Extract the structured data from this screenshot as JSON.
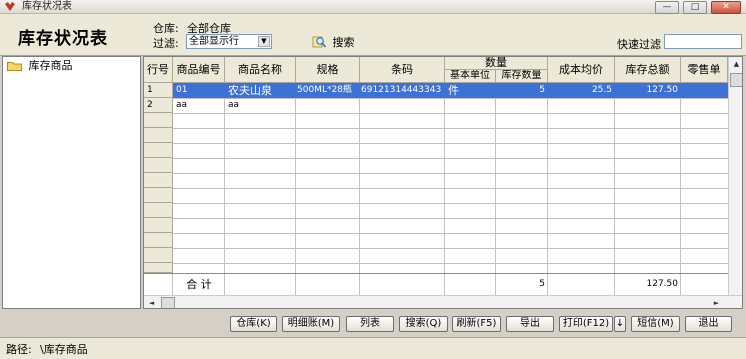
{
  "window": {
    "title": "库存状况表",
    "min_label": "—",
    "max_label": "□",
    "close_label": "✕"
  },
  "header": {
    "page_title": "库存状况表",
    "warehouse_label": "仓库:",
    "warehouse_value": "全部仓库",
    "filter_label": "过滤:",
    "filter_value": "全部显示行",
    "search_label": "搜索",
    "quick_filter_label": "快速过滤",
    "quick_filter_value": ""
  },
  "tree": {
    "items": [
      {
        "label": "库存商品",
        "icon": "folder-icon"
      }
    ]
  },
  "grid": {
    "columns": {
      "row_no": "行号",
      "code": "商品编号",
      "name": "商品名称",
      "spec": "规格",
      "barcode": "条码",
      "qty_group": "数量",
      "unit": "基本单位",
      "stock_qty": "库存数量",
      "avg_cost": "成本均价",
      "total": "库存总额",
      "retail": "零售单"
    },
    "rows": [
      {
        "row_no": "1",
        "code": "01",
        "name": "农夫山泉",
        "spec": "500ML*28瓶",
        "barcode": "6912131444334​3",
        "unit": "件",
        "stock_qty": "5",
        "avg_cost": "25.5",
        "total": "127.50",
        "retail": ""
      },
      {
        "row_no": "2",
        "code": "aa",
        "name": "aa",
        "spec": "",
        "barcode": "",
        "unit": "",
        "stock_qty": "",
        "avg_cost": "",
        "total": "",
        "retail": ""
      }
    ],
    "total_row": {
      "label": "合  计",
      "stock_qty": "5",
      "total": "127.50"
    }
  },
  "buttons": {
    "warehouse": "仓库(K)",
    "detail": "明细账(M)",
    "list": "列表",
    "search": "搜索(Q)",
    "refresh": "刷新(F5)",
    "export": "导出",
    "print": "打印(F12)",
    "print_more": "↓",
    "sms": "短信(M)",
    "exit": "退出"
  },
  "status": {
    "path_label": "路径:",
    "path_value": "\\库存商品"
  },
  "colors": {
    "selection": "#3c72d6",
    "panel": "#ece9d8",
    "frame": "#d4d0c8"
  }
}
